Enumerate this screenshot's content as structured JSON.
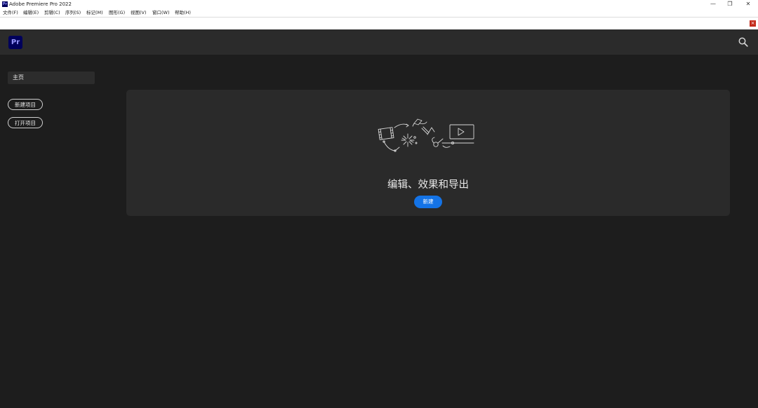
{
  "window": {
    "title": "Adobe Premiere Pro 2022",
    "app_icon": "Pr",
    "controls": {
      "minimize": "—",
      "maximize": "❐",
      "close": "✕"
    }
  },
  "menu": [
    "文件(F)",
    "编辑(E)",
    "剪辑(C)",
    "序列(S)",
    "标记(M)",
    "图形(G)",
    "视图(V)",
    "窗口(W)",
    "帮助(H)"
  ],
  "band": {
    "close_glyph": "×"
  },
  "header": {
    "logo": "Pr"
  },
  "sidebar": {
    "home": "主页",
    "new_project": "新建项目",
    "open_project": "打开项目"
  },
  "card": {
    "title": "编辑、效果和导出",
    "button": "新建"
  },
  "colors": {
    "accent": "#1473e6",
    "brand": "#00005b",
    "brand_text": "#9999ff",
    "background": "#1d1d1d",
    "card": "#2a2a2a"
  }
}
